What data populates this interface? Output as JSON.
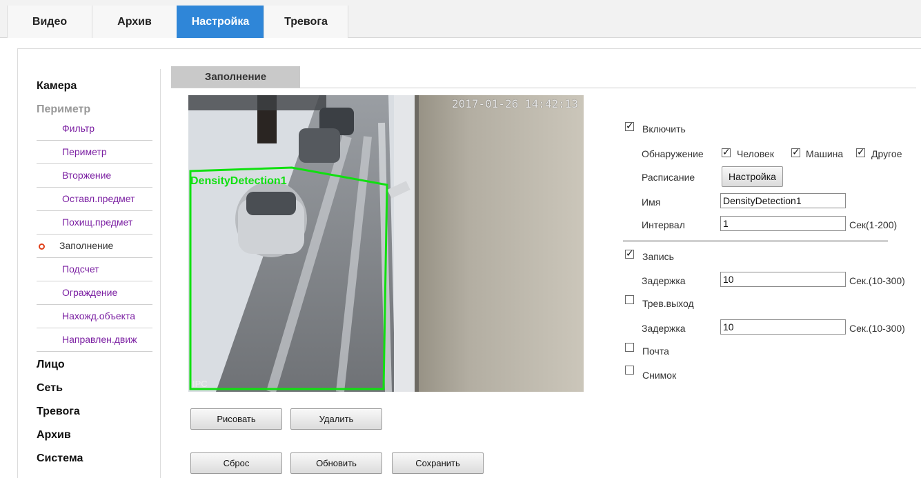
{
  "top_tabs": [
    "Видео",
    "Архив",
    "Настройка",
    "Тревога"
  ],
  "top_tab_active": "Настройка",
  "nav": {
    "camera": "Камера",
    "perimeter": "Периметр",
    "sub_items": [
      "Фильтр",
      "Периметр",
      "Вторжение",
      "Оставл.предмет",
      "Похищ.предмет",
      "Заполнение",
      "Подсчет",
      "Ограждение",
      "Нахожд.объекта",
      "Направлен.движ"
    ],
    "active_sub_item": "Заполнение",
    "lower": [
      "Лицо",
      "Сеть",
      "Тревога",
      "Архив",
      "Система"
    ]
  },
  "content_tab": "Заполнение",
  "video": {
    "timestamp": "2017-01-26 14:42:13",
    "camera_tag": "IPC",
    "detection_label": "DensityDetection1",
    "detection_color": "#10e010"
  },
  "buttons": {
    "draw": "Рисовать",
    "delete": "Удалить",
    "reset": "Сброс",
    "refresh": "Обновить",
    "save": "Сохранить"
  },
  "settings": {
    "enable": {
      "label": "Включить",
      "checked": true
    },
    "detection_label": "Обнаружение",
    "human": {
      "label": "Человек",
      "checked": true
    },
    "vehicle": {
      "label": "Машина",
      "checked": true
    },
    "other": {
      "label": "Другое",
      "checked": true
    },
    "schedule_label": "Расписание",
    "schedule_button": "Настройка",
    "name_label": "Имя",
    "name_value": "DensityDetection1",
    "interval_label": "Интервал",
    "interval_value": "1",
    "interval_unit": "Сек(1-200)",
    "record": {
      "label": "Запись",
      "checked": true
    },
    "record_delay_label": "Задержка",
    "record_delay_value": "10",
    "record_delay_unit": "Сек.(10-300)",
    "alarm_out": {
      "label": "Трев.выход",
      "checked": false
    },
    "alarm_delay_label": "Задержка",
    "alarm_delay_value": "10",
    "alarm_delay_unit": "Сек.(10-300)",
    "mail": {
      "label": "Почта",
      "checked": false
    },
    "snapshot": {
      "label": "Снимок",
      "checked": false
    }
  },
  "colors": {
    "active_tab": "#2f86d8",
    "sub_nav_text": "#7b1fa2",
    "active_marker": "#e0401a"
  }
}
